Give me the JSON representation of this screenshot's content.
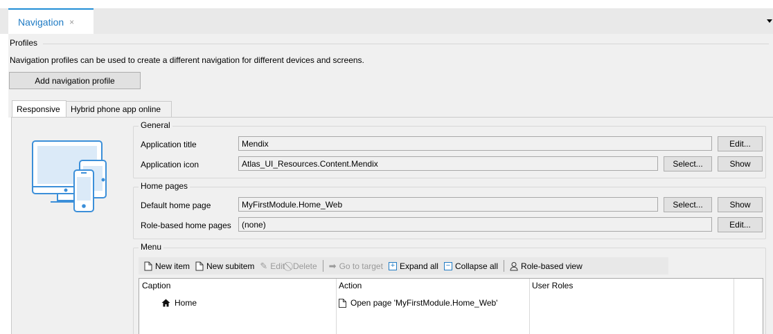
{
  "document_tab": {
    "title": "Navigation",
    "close_glyph": "×"
  },
  "profiles": {
    "legend": "Profiles",
    "description": "Navigation profiles can be used to create a different navigation for different devices and screens.",
    "add_button": "Add navigation profile"
  },
  "profile_tabs": [
    {
      "label": "Responsive",
      "active": true
    },
    {
      "label": "Hybrid phone app online",
      "active": false
    }
  ],
  "general": {
    "legend": "General",
    "app_title_label": "Application title",
    "app_title_value": "Mendix",
    "app_title_edit": "Edit...",
    "app_icon_label": "Application icon",
    "app_icon_value": "Atlas_UI_Resources.Content.Mendix",
    "app_icon_select": "Select...",
    "app_icon_show": "Show"
  },
  "home_pages": {
    "legend": "Home pages",
    "default_label": "Default home page",
    "default_value": "MyFirstModule.Home_Web",
    "default_select": "Select...",
    "default_show": "Show",
    "role_label": "Role-based home pages",
    "role_value": "(none)",
    "role_edit": "Edit..."
  },
  "menu": {
    "legend": "Menu",
    "toolbar": {
      "new_item": "New item",
      "new_subitem": "New subitem",
      "edit": "Edit",
      "delete": "Delete",
      "go_to_target": "Go to target",
      "expand_all": "Expand all",
      "collapse_all": "Collapse all",
      "role_based_view": "Role-based view"
    },
    "columns": [
      "Caption",
      "Action",
      "User Roles"
    ],
    "rows": [
      {
        "caption": "Home",
        "action": "Open page 'MyFirstModule.Home_Web'",
        "roles": ""
      }
    ]
  },
  "colors": {
    "accent": "#1f7bc4",
    "panel": "#f0f0f0",
    "illustration": "#3b8fd9"
  }
}
